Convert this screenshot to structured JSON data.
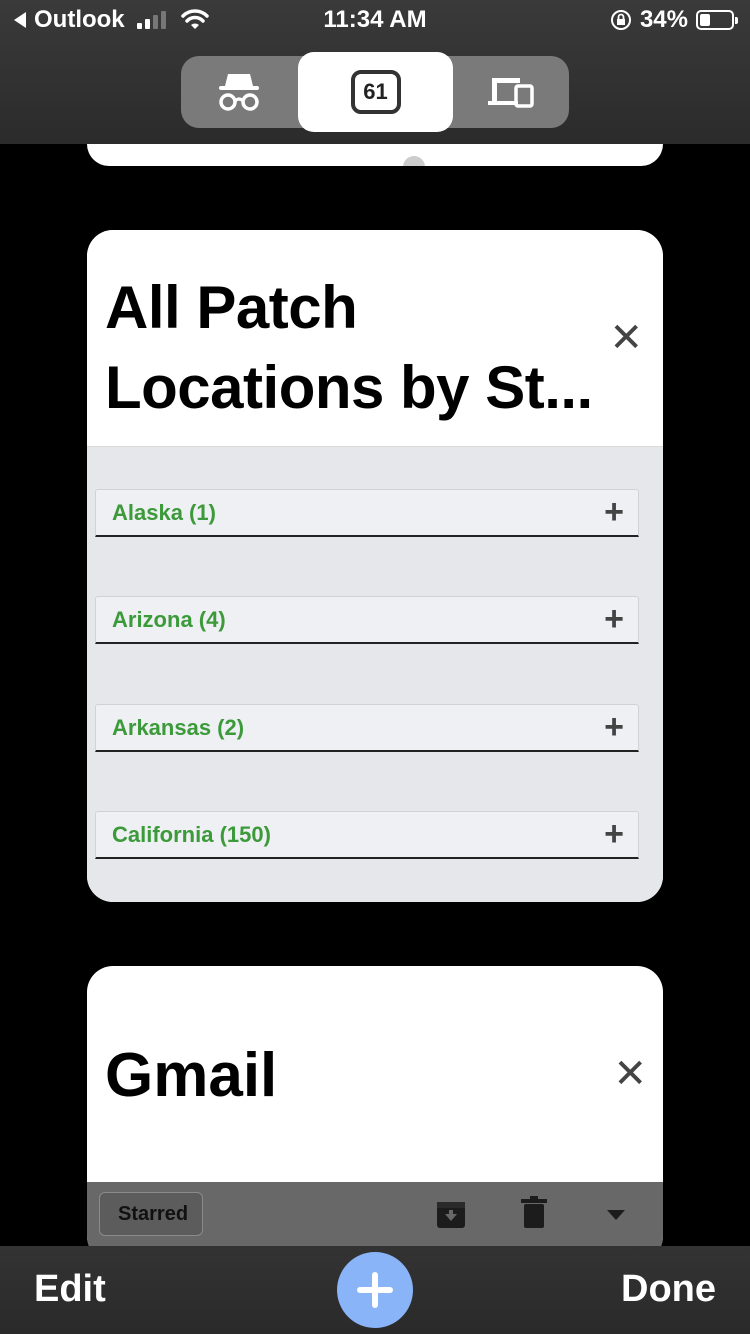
{
  "status_bar": {
    "back_app": "Outlook",
    "time": "11:34 AM",
    "battery_percent": "34%",
    "battery_level": 0.34,
    "signal_bars": 2
  },
  "tab_switcher": {
    "incognito_icon": "incognito-icon",
    "tab_count": "61",
    "devices_icon": "devices-icon",
    "active_segment": "tabs"
  },
  "cards": [
    {
      "title": "All Patch Locations by St...",
      "title_line1": "All Patch",
      "title_line2": "Locations by St...",
      "close_icon": "close-icon",
      "accordion": [
        {
          "label": "Alaska (1)"
        },
        {
          "label": "Arizona (4)"
        },
        {
          "label": "Arkansas (2)"
        },
        {
          "label": "California (150)"
        }
      ]
    },
    {
      "title": "Gmail",
      "close_icon": "close-icon",
      "toolbar": {
        "starred_label": "Starred",
        "archive_icon": "archive-icon",
        "trash_icon": "trash-icon",
        "dropdown_icon": "caret-down-icon"
      }
    }
  ],
  "bottom_bar": {
    "edit_label": "Edit",
    "add_icon": "plus-icon",
    "done_label": "Done"
  },
  "colors": {
    "accent_blue": "#8ab4f8",
    "accordion_text_green": "#3c9a3a",
    "background": "#000000"
  }
}
